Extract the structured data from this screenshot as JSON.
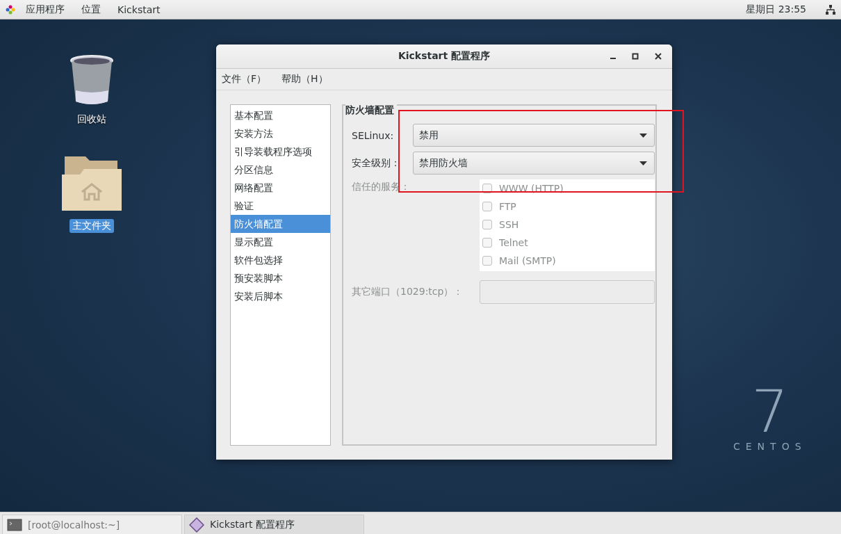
{
  "top_bar": {
    "menus": [
      "应用程序",
      "位置",
      "Kickstart"
    ],
    "clock": "星期日 23:55"
  },
  "desktop_icons": [
    {
      "label": "回收站",
      "kind": "trash",
      "selected": false
    },
    {
      "label": "主文件夹",
      "kind": "home",
      "selected": true
    }
  ],
  "window": {
    "title": "Kickstart 配置程序",
    "menu": [
      "文件（F）",
      "帮助（H）"
    ],
    "sidebar": [
      {
        "label": "基本配置",
        "selected": false
      },
      {
        "label": "安装方法",
        "selected": false
      },
      {
        "label": "引导装载程序选项",
        "selected": false
      },
      {
        "label": "分区信息",
        "selected": false
      },
      {
        "label": "网络配置",
        "selected": false
      },
      {
        "label": "验证",
        "selected": false
      },
      {
        "label": "防火墙配置",
        "selected": true
      },
      {
        "label": "显示配置",
        "selected": false
      },
      {
        "label": "软件包选择",
        "selected": false
      },
      {
        "label": "预安装脚本",
        "selected": false
      },
      {
        "label": "安装后脚本",
        "selected": false
      }
    ],
    "panel": {
      "title": "防火墙配置",
      "selinux": {
        "label": "SELinux:",
        "value": "禁用"
      },
      "security_level": {
        "label": "安全级别：",
        "value": "禁用防火墙"
      },
      "trusted_services": {
        "label": "信任的服务：",
        "disabled": true,
        "items": [
          {
            "label": "WWW (HTTP)",
            "checked": false
          },
          {
            "label": "FTP",
            "checked": false
          },
          {
            "label": "SSH",
            "checked": false
          },
          {
            "label": "Telnet",
            "checked": false
          },
          {
            "label": "Mail (SMTP)",
            "checked": false
          }
        ]
      },
      "other_ports": {
        "label": "其它端口（1029:tcp）：",
        "disabled": true
      }
    }
  },
  "logo": {
    "number": "7",
    "name": "CENTOS"
  },
  "taskbar": [
    {
      "label": "[root@localhost:~]",
      "kind": "terminal",
      "selected": false
    },
    {
      "label": "Kickstart 配置程序",
      "kind": "kickstart",
      "selected": true
    }
  ]
}
